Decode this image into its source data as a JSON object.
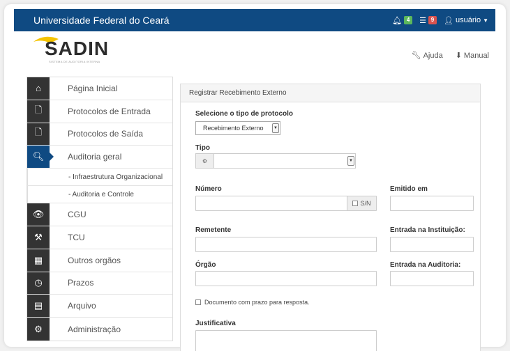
{
  "topbar": {
    "brand": "Universidade Federal do Ceará",
    "notif_count": "4",
    "notif_color": "#5cb85c",
    "msg_count": "9",
    "msg_color": "#d9534f",
    "user_label": "usuário"
  },
  "logo": {
    "name": "SADIN",
    "subtitle": "SISTEMA DE AUDITORIA INTERNA"
  },
  "help": {
    "help_label": "Ajuda",
    "manual_label": "Manual"
  },
  "sidebar": {
    "items": [
      {
        "label": "Página Inicial",
        "icon": "home-icon"
      },
      {
        "label": "Protocolos de Entrada",
        "icon": "file-in-icon"
      },
      {
        "label": "Protocolos de Saída",
        "icon": "file-out-icon"
      },
      {
        "label": "Auditoria geral",
        "icon": "search-icon"
      },
      {
        "label": "CGU",
        "icon": "eye-icon"
      },
      {
        "label": "TCU",
        "icon": "gavel-icon"
      },
      {
        "label": "Outros orgãos",
        "icon": "building-icon"
      },
      {
        "label": "Prazos",
        "icon": "clock-icon"
      },
      {
        "label": "Arquivo",
        "icon": "archive-icon"
      },
      {
        "label": "Administração",
        "icon": "gear-icon"
      }
    ],
    "subitems": [
      "- Infraestrutura Organizacional",
      "- Auditoria e Controle"
    ]
  },
  "form": {
    "panel_title": "Registrar Recebimento Externo",
    "tipo_protocolo_label": "Selecione o tipo de protocolo",
    "tipo_protocolo_value": "Recebimento Externo",
    "tipo_label": "Tipo",
    "numero_label": "Número",
    "sn_label": "S/N",
    "emitido_label": "Emitido em",
    "remetente_label": "Remetente",
    "entrada_inst_label": "Entrada na Instituição:",
    "orgao_label": "Órgão",
    "entrada_aud_label": "Entrada na Auditoria:",
    "doc_prazo_label": "Documento com prazo para resposta.",
    "justificativa_label": "Justificativa"
  }
}
